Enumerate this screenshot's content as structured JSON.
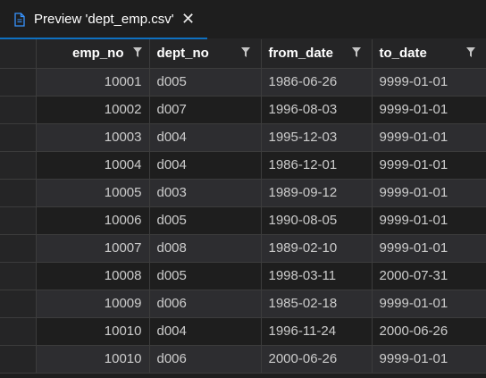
{
  "tab": {
    "title": "Preview 'dept_emp.csv'",
    "file_icon": "file-icon",
    "close_glyph": "✕"
  },
  "grid": {
    "columns": [
      "emp_no",
      "dept_no",
      "from_date",
      "to_date"
    ],
    "rows": [
      [
        "10001",
        "d005",
        "1986-06-26",
        "9999-01-01"
      ],
      [
        "10002",
        "d007",
        "1996-08-03",
        "9999-01-01"
      ],
      [
        "10003",
        "d004",
        "1995-12-03",
        "9999-01-01"
      ],
      [
        "10004",
        "d004",
        "1986-12-01",
        "9999-01-01"
      ],
      [
        "10005",
        "d003",
        "1989-09-12",
        "9999-01-01"
      ],
      [
        "10006",
        "d005",
        "1990-08-05",
        "9999-01-01"
      ],
      [
        "10007",
        "d008",
        "1989-02-10",
        "9999-01-01"
      ],
      [
        "10008",
        "d005",
        "1998-03-11",
        "2000-07-31"
      ],
      [
        "10009",
        "d006",
        "1985-02-18",
        "9999-01-01"
      ],
      [
        "10010",
        "d004",
        "1996-11-24",
        "2000-06-26"
      ],
      [
        "10010",
        "d006",
        "2000-06-26",
        "9999-01-01"
      ]
    ]
  },
  "colors": {
    "accent": "#0e70c0",
    "background": "#1e1e1e",
    "header_background": "#252526",
    "striped_row": "#2d2d30"
  }
}
